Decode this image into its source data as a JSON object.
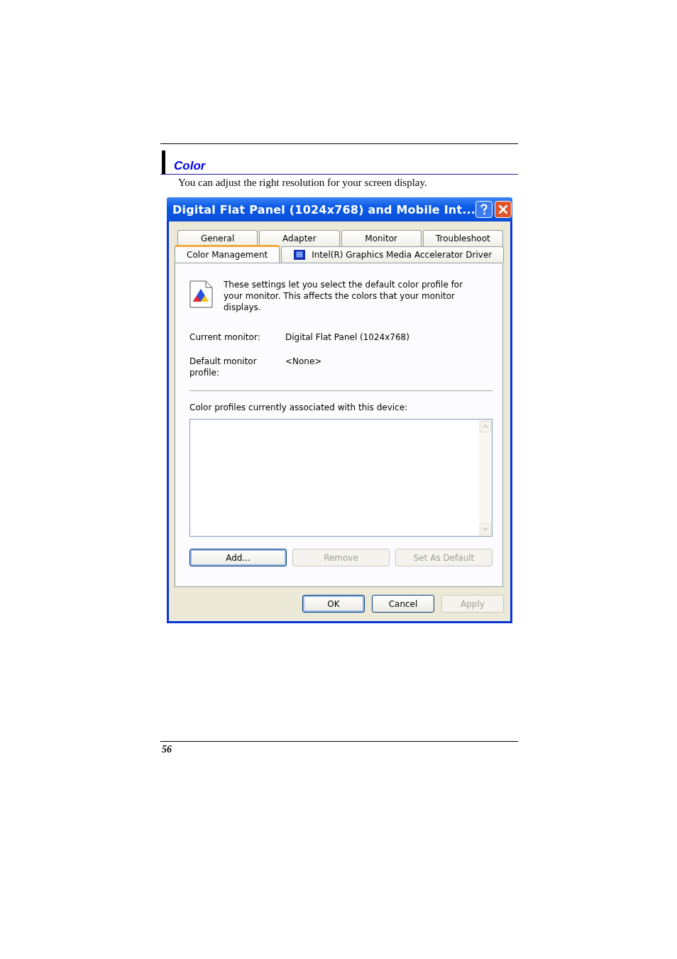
{
  "section": {
    "heading": "Color",
    "intro": "You can adjust the right resolution for your screen display."
  },
  "window": {
    "title": "Digital Flat Panel (1024x768) and Mobile Int...",
    "tab_rows": [
      [
        {
          "label": "General",
          "selected": false
        },
        {
          "label": "Adapter",
          "selected": false
        },
        {
          "label": "Monitor",
          "selected": false
        },
        {
          "label": "Troubleshoot",
          "selected": false
        }
      ],
      [
        {
          "label": "Color Management",
          "selected": true
        },
        {
          "label": "Intel(R) Graphics Media Accelerator Driver",
          "selected": false,
          "kind": "icon"
        }
      ]
    ],
    "description": "These settings let you select the default color profile for your monitor. This affects the colors that your monitor displays.",
    "fields": [
      {
        "label": "Current monitor:",
        "value": "Digital Flat Panel (1024x768)"
      },
      {
        "label": "Default monitor profile:",
        "value": "<None>"
      }
    ],
    "profiles_label": "Color profiles currently associated with this device:",
    "profile_buttons": [
      {
        "label": "Add...",
        "disabled": false,
        "default": true
      },
      {
        "label": "Remove",
        "disabled": true,
        "default": false
      },
      {
        "label": "Set As Default",
        "disabled": true,
        "default": false
      }
    ],
    "dialog_buttons": [
      {
        "label": "OK",
        "disabled": false,
        "default": true
      },
      {
        "label": "Cancel",
        "disabled": false,
        "default": false
      },
      {
        "label": "Apply",
        "disabled": true,
        "default": false
      }
    ]
  },
  "page_number": "56"
}
